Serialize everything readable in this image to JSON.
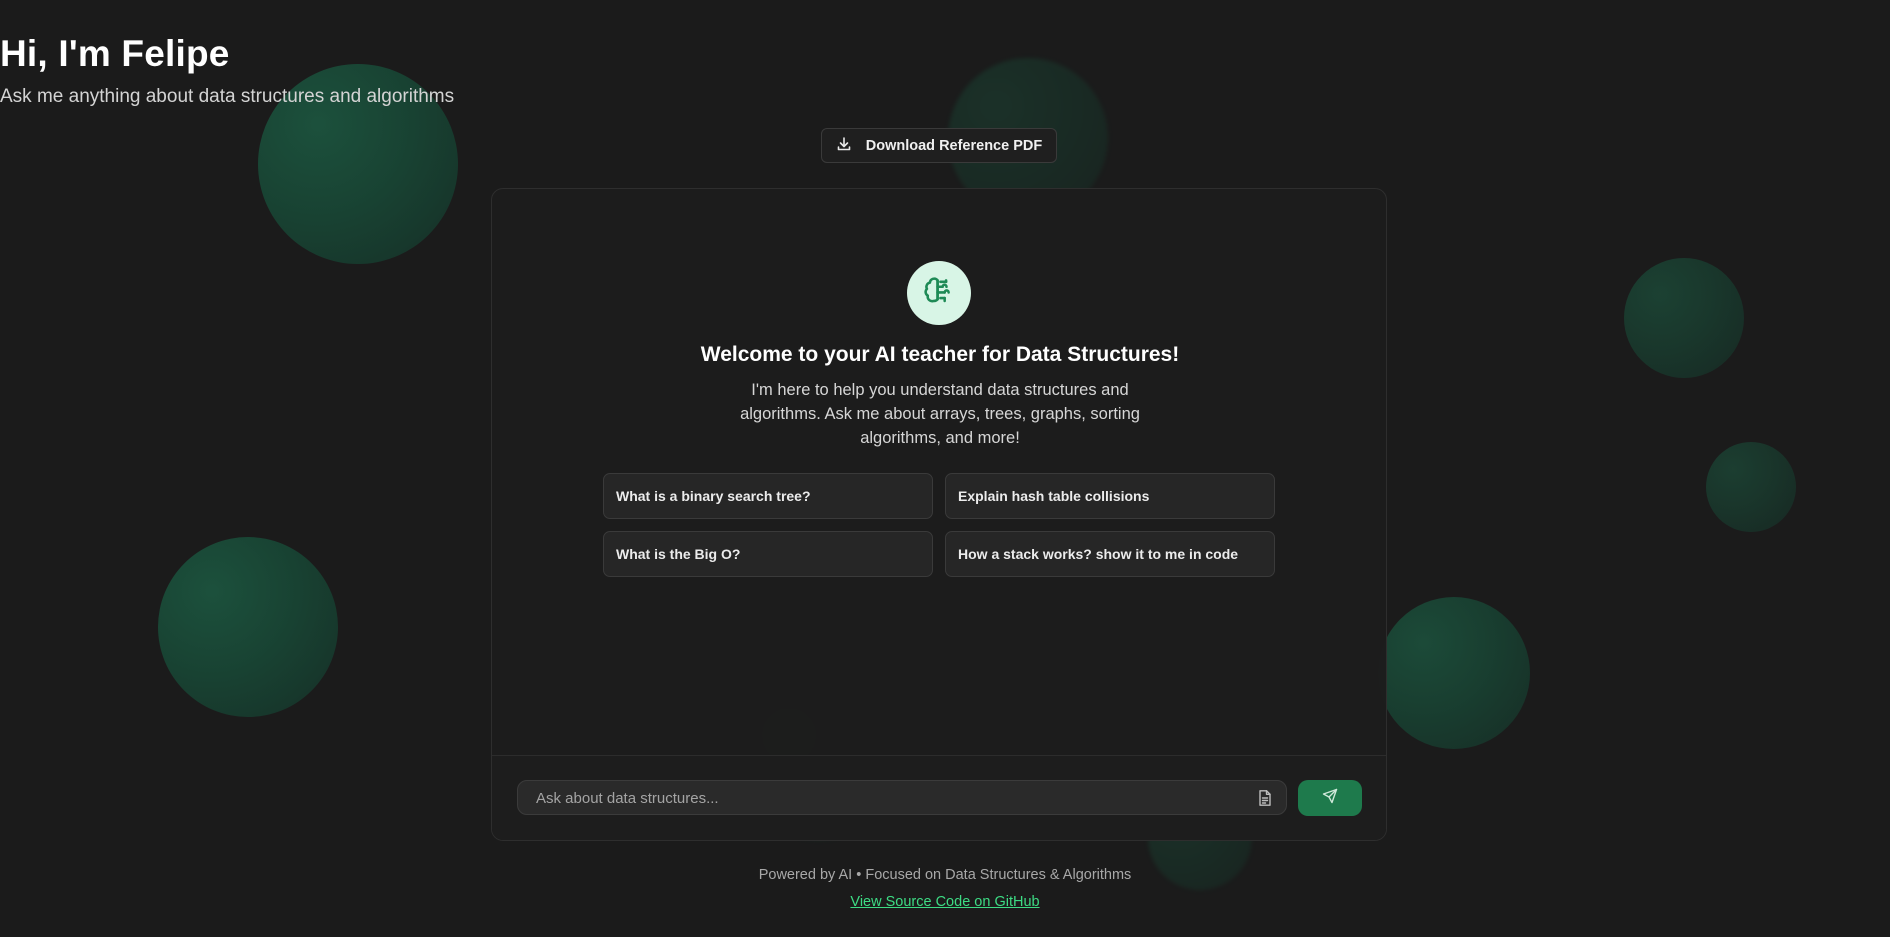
{
  "header": {
    "title": "Hi, I'm Felipe",
    "subtitle": "Ask me anything about data structures and algorithms",
    "download_label": "Download Reference PDF"
  },
  "welcome": {
    "avatar_icon": "brain-icon",
    "title": "Welcome to your AI teacher for Data Structures!",
    "text": "I'm here to help you understand data structures and algorithms. Ask me about arrays, trees, graphs, sorting algorithms, and more!"
  },
  "suggestions": [
    "What is a binary search tree?",
    "Explain hash table collisions",
    "What is the Big O?",
    "How a stack works? show it to me in code"
  ],
  "input": {
    "placeholder": "Ask about data structures...",
    "value": ""
  },
  "footer": {
    "text": "Powered by AI • Focused on Data Structures & Algorithms",
    "link": "View Source Code on GitHub"
  },
  "colors": {
    "background": "#1b1b1b",
    "accent": "#1e7a4c",
    "link": "#3ddc84",
    "avatar_bg": "#d8f5e6"
  }
}
